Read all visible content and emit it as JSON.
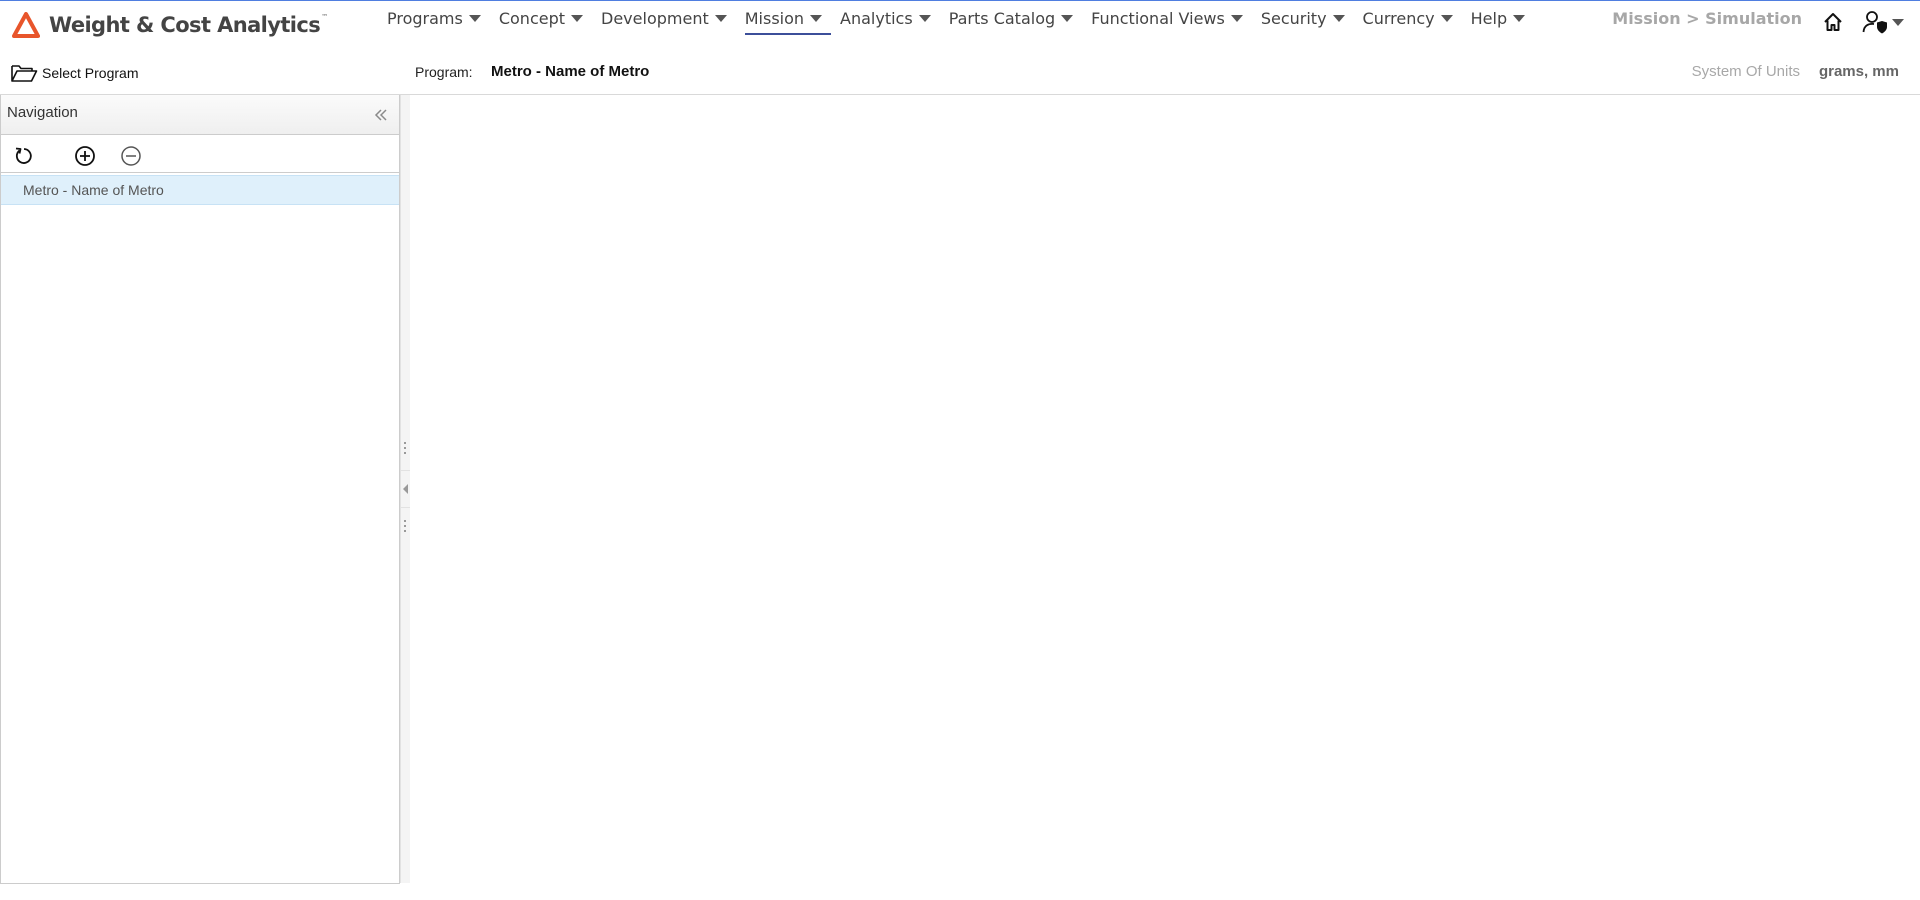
{
  "app": {
    "title": "Weight & Cost Analytics",
    "trademark": "™",
    "brand_color": "#e8552b"
  },
  "nav": {
    "items": [
      {
        "label": "Programs"
      },
      {
        "label": "Concept"
      },
      {
        "label": "Development"
      },
      {
        "label": "Mission",
        "active": true
      },
      {
        "label": "Analytics"
      },
      {
        "label": "Parts Catalog"
      },
      {
        "label": "Functional Views"
      },
      {
        "label": "Security"
      },
      {
        "label": "Currency"
      },
      {
        "label": "Help"
      }
    ],
    "active_underline_color": "#3c4f9a"
  },
  "breadcrumb": "Mission > Simulation",
  "icons": {
    "home": "home-icon",
    "user": "user-shield-icon",
    "folder": "folder-open-icon",
    "collapse": "double-chevron-left-icon",
    "refresh": "refresh-icon",
    "expand": "plus-circle-icon",
    "collapse_all": "minus-circle-icon"
  },
  "subheader": {
    "select_program": "Select Program",
    "program_label": "Program:",
    "program_value": "Metro - Name of Metro",
    "units_label": "System Of Units",
    "units_value": "grams, mm"
  },
  "navigation": {
    "title": "Navigation",
    "tree": [
      {
        "label": "Metro - Name of Metro",
        "selected": true
      }
    ],
    "selected_bg": "#dff0fb"
  }
}
